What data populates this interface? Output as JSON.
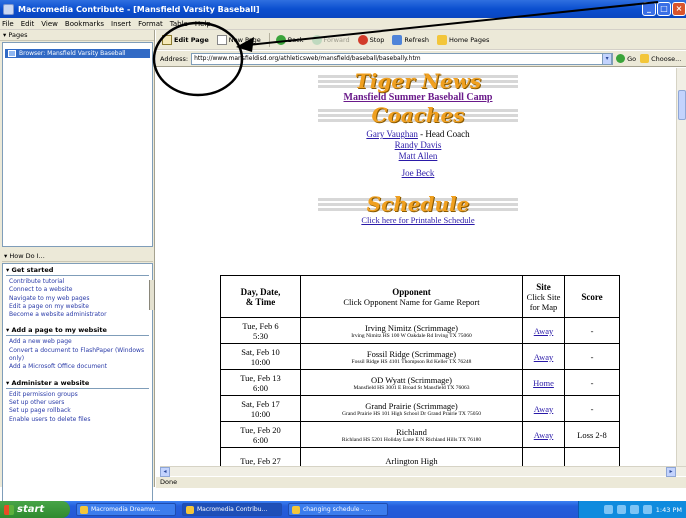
{
  "window": {
    "title": "Macromedia Contribute - [Mansfield Varsity Baseball]"
  },
  "menu": [
    "File",
    "Edit",
    "View",
    "Bookmarks",
    "Insert",
    "Format",
    "Table",
    "Help"
  ],
  "left_panel": {
    "pages_header": "Pages",
    "page_item": "Browser: Mansfield Varsity Baseball",
    "howdo_header": "How Do I...",
    "sections": [
      {
        "title": "Get started",
        "items": [
          "Contribute tutorial",
          "Connect to a website",
          "Navigate to my web pages",
          "Edit a page on my website",
          "Become a website administrator"
        ]
      },
      {
        "title": "Add a page to my website",
        "items": [
          "Add a new web page",
          "Convert a document to FlashPaper (Windows only)",
          "Add a Microsoft Office document"
        ]
      },
      {
        "title": "Administer a website",
        "items": [
          "Edit permission groups",
          "Set up other users",
          "Set up page rollback",
          "Enable users to delete files"
        ]
      }
    ]
  },
  "toolbar": {
    "edit_page": "Edit Page",
    "new_page": "New Page",
    "back": "Back",
    "forward": "Forward",
    "stop": "Stop",
    "refresh": "Refresh",
    "home": "Home Pages"
  },
  "address": {
    "label": "Address:",
    "url": "http://www.mansfieldisd.org/athleticsweb/mansfield/baseball/basebally.htm",
    "go": "Go",
    "choose": "Choose..."
  },
  "page": {
    "banner1": "Tiger News",
    "camp_link": "Mansfield Summer Baseball Camp",
    "banner2": "Coaches",
    "head_coach_name": "Gary Vaughan",
    "head_coach_role": " - Head Coach",
    "coaches": [
      "Randy Davis",
      "Matt Allen"
    ],
    "extra_coach": "Joe Beck",
    "banner3": "Schedule",
    "print_link": "Click here for Printable Schedule",
    "table": {
      "headers": {
        "date_line1": "Day, Date,",
        "date_line2": "& Time",
        "opp_title": "Opponent",
        "opp_sub": "Click Opponent Name for Game Report",
        "site_title": "Site",
        "site_sub": "Click Site for Map",
        "score": "Score"
      },
      "rows": [
        {
          "day": "Tue, Feb 6",
          "time": "5:30",
          "opponent": "Irving Nimitz (Scrimmage)",
          "location": "Irving Nimitz HS 100 W Oakdale Rd Irving TX 75060",
          "site": "Away",
          "score": "-"
        },
        {
          "day": "Sat, Feb 10",
          "time": "10:00",
          "opponent": "Fossil Ridge (Scrimmage)",
          "location": "Fossil Ridge HS 4101 Thompson Rd Keller TX 76248",
          "site": "Away",
          "score": "-"
        },
        {
          "day": "Tue, Feb 13",
          "time": "6:00",
          "opponent": "OD Wyatt (Scrimmage)",
          "location": "Mansfield HS 3001 E Broad St Mansfield TX 76063",
          "site": "Home",
          "score": "-"
        },
        {
          "day": "Sat, Feb 17",
          "time": "10:00",
          "opponent": "Grand Prairie (Scrimmage)",
          "location": "Grand Prairie HS 101 High School Dr Grand Prairie TX 75050",
          "site": "Away",
          "score": "-"
        },
        {
          "day": "Tue, Feb 20",
          "time": "6:00",
          "opponent": "Richland",
          "location": "Richland HS 5201 Holiday Lane E N Richland Hills TX 76180",
          "site": "Away",
          "score": "Loss 2-8"
        },
        {
          "day": "Tue, Feb 27",
          "time": "",
          "opponent": "Arlington High",
          "location": "",
          "site": "",
          "score": ""
        }
      ]
    }
  },
  "status": "Done",
  "taskbar": {
    "start": "start",
    "items": [
      "Macromedia Dreamw...",
      "Macromedia Contribu...",
      "changing schedule - ..."
    ],
    "clock": "1:43 PM"
  }
}
